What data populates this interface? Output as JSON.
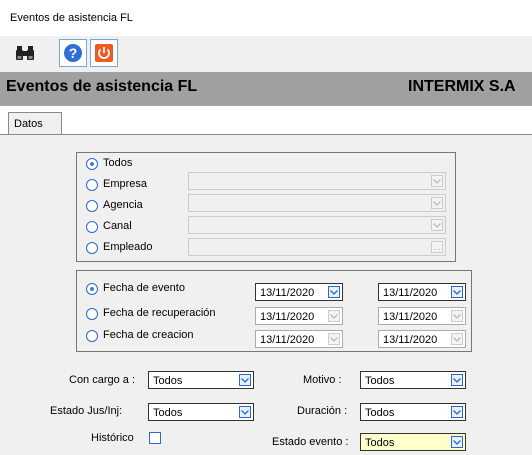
{
  "window": {
    "title": "Eventos de asistencia FL"
  },
  "toolbar": {
    "icons": [
      "binoculars-icon",
      "help-icon",
      "power-icon"
    ]
  },
  "header": {
    "title": "Eventos de asistencia FL",
    "company": "INTERMIX S.A"
  },
  "tabs": [
    {
      "label": "Datos",
      "selected": true
    }
  ],
  "filter_scope": {
    "selected": "Todos",
    "options": [
      {
        "label": "Todos",
        "has_field": false
      },
      {
        "label": "Empresa",
        "has_field": true,
        "field": "dropdown",
        "value": ""
      },
      {
        "label": "Agencia",
        "has_field": true,
        "field": "dropdown",
        "value": ""
      },
      {
        "label": "Canal",
        "has_field": true,
        "field": "dropdown",
        "value": ""
      },
      {
        "label": "Empleado",
        "has_field": true,
        "field": "lookup",
        "value": "",
        "button": "..."
      }
    ]
  },
  "date_filter": {
    "selected": "Fecha de evento",
    "options": [
      {
        "label": "Fecha de evento",
        "from": "13/11/2020",
        "to": "13/11/2020"
      },
      {
        "label": "Fecha de recuperación",
        "from": "13/11/2020",
        "to": "13/11/2020"
      },
      {
        "label": "Fecha de creacion",
        "from": "13/11/2020",
        "to": "13/11/2020"
      }
    ]
  },
  "filters": {
    "con_cargo_label": "Con cargo a :",
    "con_cargo_value": "Todos",
    "motivo_label": "Motivo :",
    "motivo_value": "Todos",
    "estado_jus_label": "Estado Jus/Inj:",
    "estado_jus_value": "Todos",
    "duracion_label": "Duración :",
    "duracion_value": "Todos",
    "historico_label": "Histórico",
    "historico_checked": false,
    "estado_evento_label": "Estado evento :",
    "estado_evento_value": "Todos"
  },
  "colors": {
    "header_bg": "#a0a0a0",
    "accent": "#2a6ac8",
    "highlight": "#ffffcc"
  }
}
